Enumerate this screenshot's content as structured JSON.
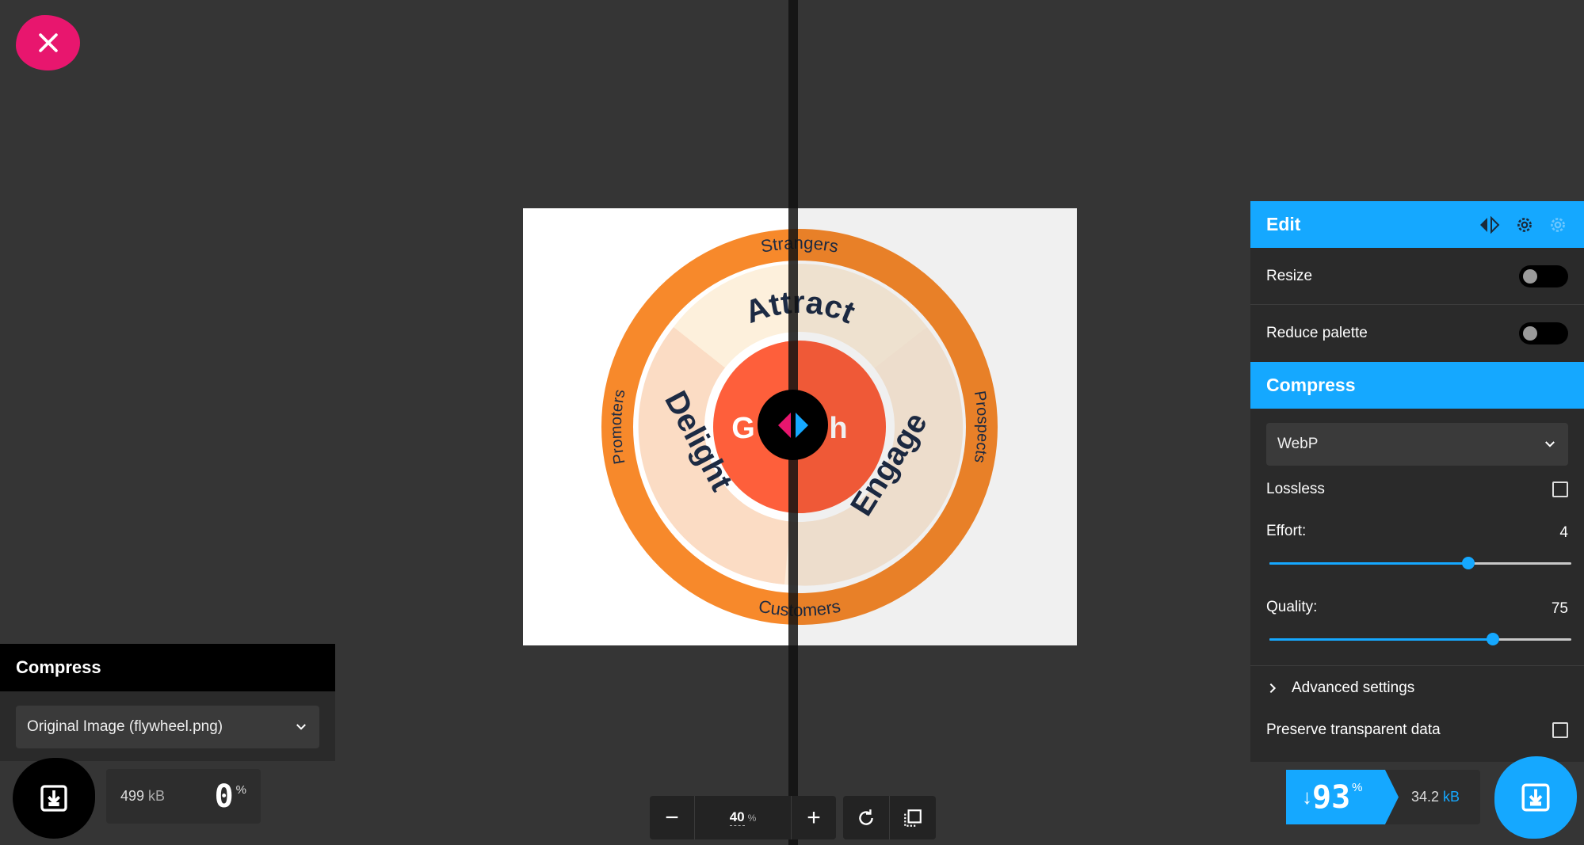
{
  "close": {
    "label": "Close"
  },
  "image": {
    "center_left": "G",
    "center_right": "h",
    "ring_outer_top": "Strangers",
    "ring_outer_right": "Prospects",
    "ring_outer_bottom": "Customers",
    "ring_outer_left": "Promoters",
    "ring_inner_top": "Attract",
    "ring_inner_right": "Engage",
    "ring_inner_left": "Delight"
  },
  "right_panel": {
    "edit_title": "Edit",
    "resize_label": "Resize",
    "reduce_palette_label": "Reduce palette",
    "compress_title": "Compress",
    "format_value": "WebP",
    "lossless_label": "Lossless",
    "effort_label": "Effort:",
    "effort_value": "4",
    "effort_fraction": 0.66,
    "quality_label": "Quality:",
    "quality_value": "75",
    "quality_fraction": 0.74,
    "advanced_label": "Advanced settings",
    "preserve_label": "Preserve transparent data"
  },
  "left_panel": {
    "title": "Compress",
    "source_value": "Original Image (flywheel.png)",
    "size_value": "499",
    "size_unit": "kB",
    "percent": "0",
    "percent_sign": "%"
  },
  "zoom": {
    "minus": "−",
    "value": "40",
    "unit": "%",
    "plus": "+"
  },
  "result": {
    "arrow": "↓",
    "percent": "93",
    "percent_sign": "%",
    "size_value": "34.2",
    "size_unit": "kB"
  },
  "colors": {
    "accent": "#15a8ff",
    "close": "#e8166e",
    "orange": "#f7892b",
    "center": "#fe5f3b"
  }
}
